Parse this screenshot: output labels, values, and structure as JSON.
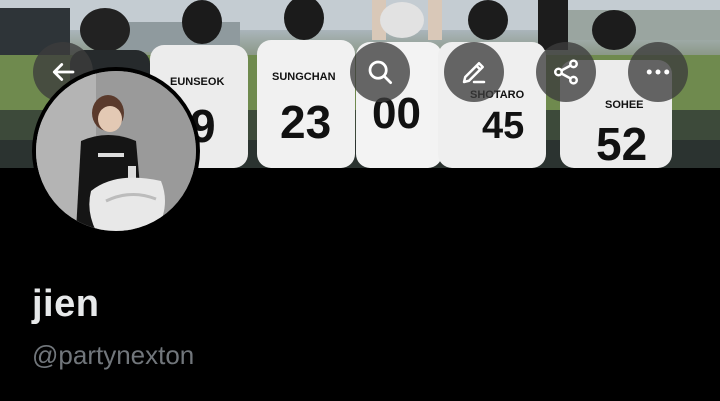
{
  "banner": {
    "jerseys": [
      {
        "name": "EUNSEOK",
        "number": "9"
      },
      {
        "name": "SUNGCHAN",
        "number": "23"
      },
      {
        "name": "",
        "number": "00"
      },
      {
        "name": "SHOTARO",
        "number": "45"
      },
      {
        "name": "SOHEE",
        "number": "52"
      }
    ]
  },
  "header_actions": [
    {
      "name": "back",
      "icon": "arrow-left-icon"
    },
    {
      "name": "search",
      "icon": "search-icon"
    },
    {
      "name": "edit",
      "icon": "pencil-icon"
    },
    {
      "name": "share",
      "icon": "share-icon"
    },
    {
      "name": "more",
      "icon": "more-horizontal-icon"
    }
  ],
  "profile": {
    "display_name": "jien",
    "handle": "@partynexton"
  },
  "colors": {
    "background": "#000000",
    "name_text": "#e7e9ea",
    "handle_text": "#71767b",
    "icon_button_bg": "#3c3c3c"
  }
}
